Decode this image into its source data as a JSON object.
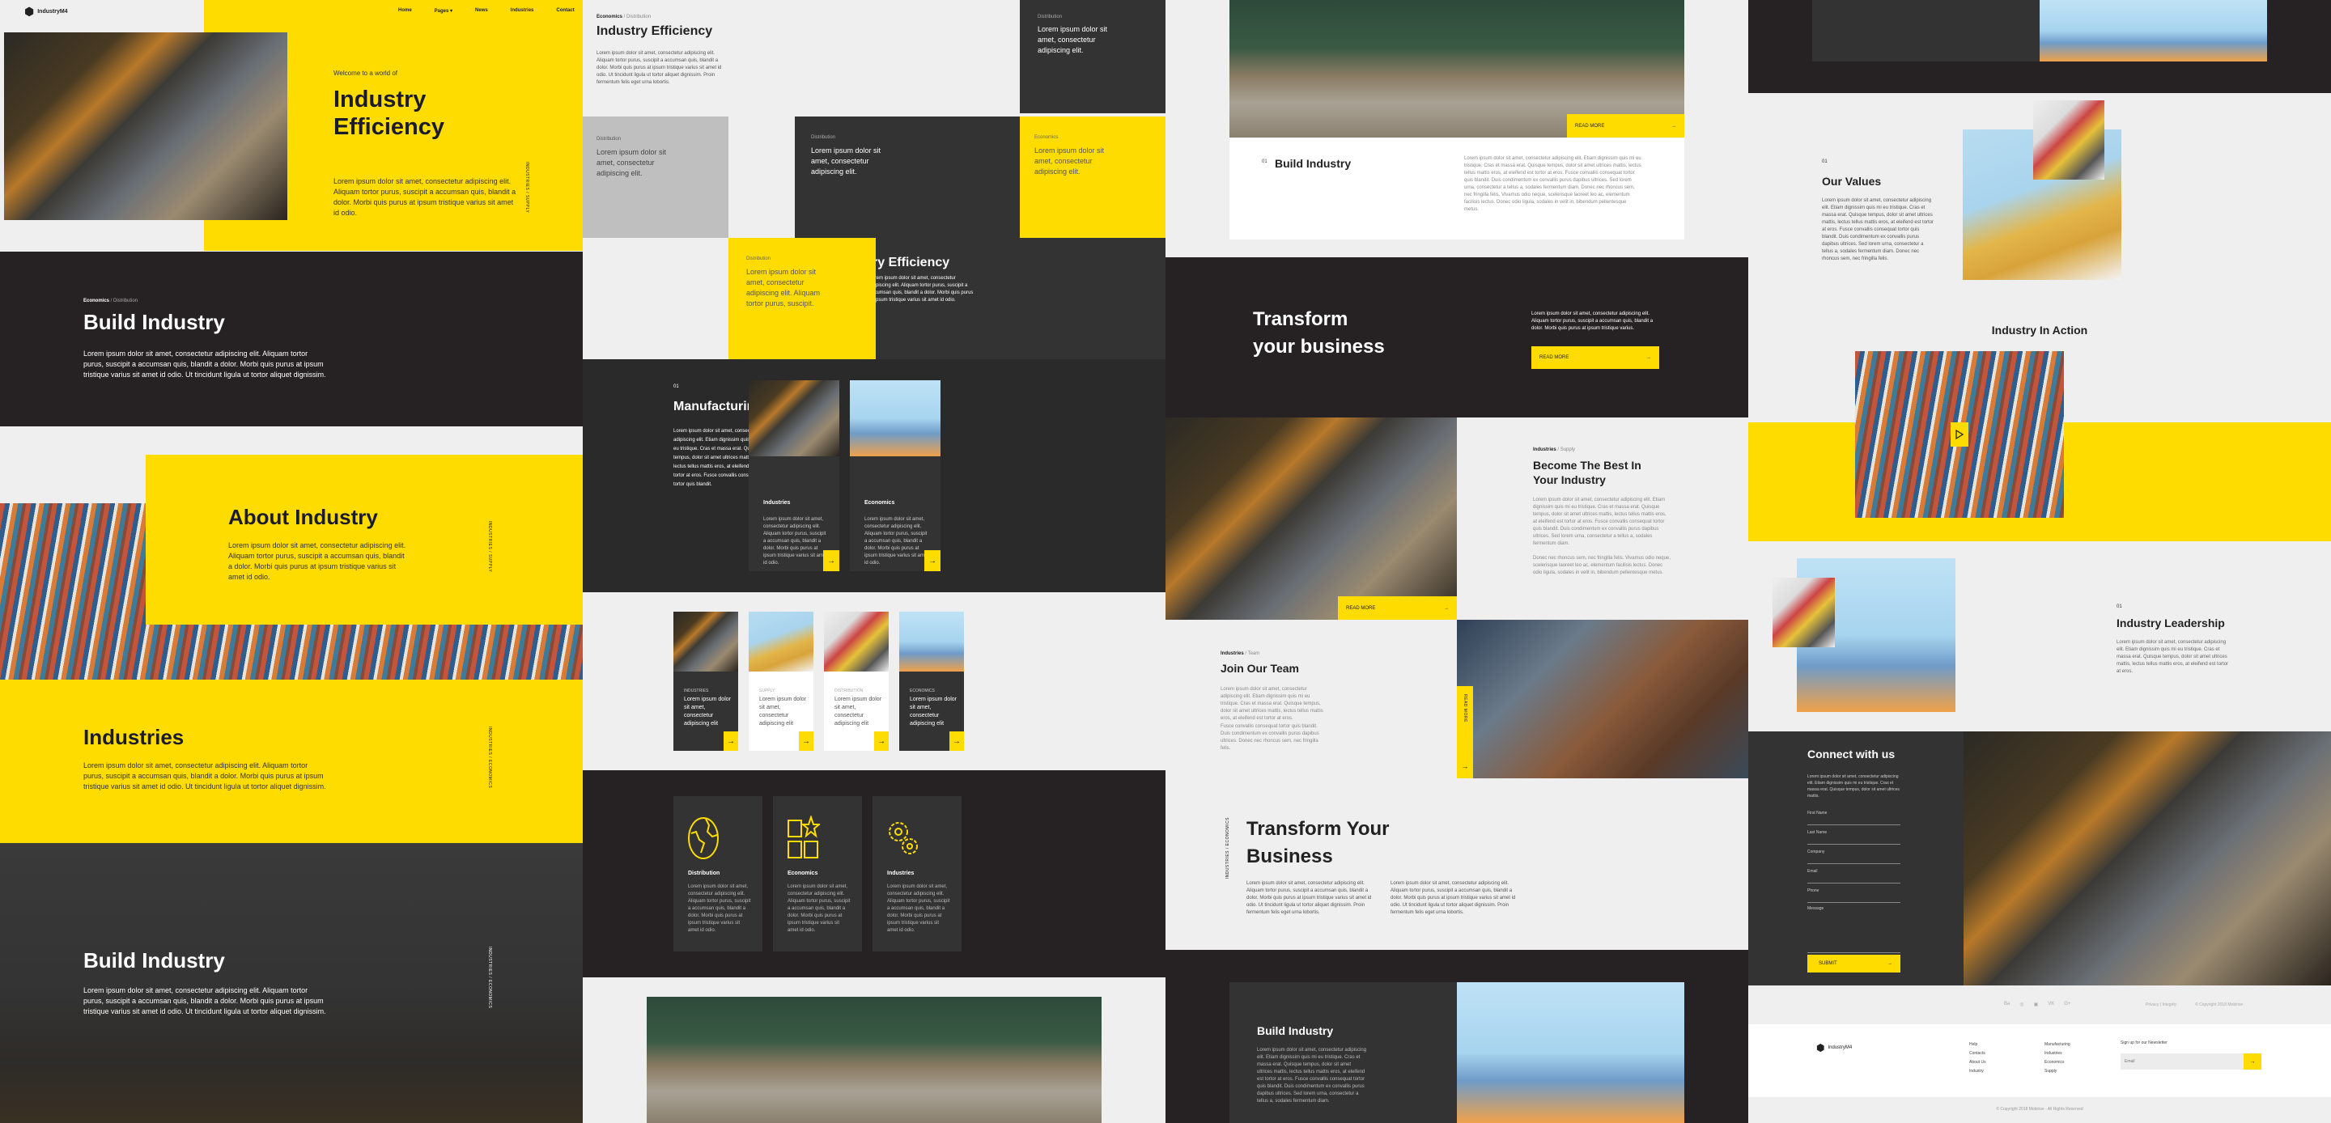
{
  "brand": {
    "name": "IndustryM4"
  },
  "nav": {
    "items": [
      "Home",
      "Pages ▾",
      "News",
      "Industries",
      "Contact"
    ]
  },
  "lorem": {
    "short": "Lorem ipsum dolor sit amet, consectetur adipiscing elit. Aliquam tortor purus, suscipit a accumsan quis, blandit a dolor. Morbi quis purus at ipsum tristique varius sit amet id odio.",
    "medium": "Lorem ipsum dolor sit amet, consectetur adipiscing elit. Aliquam tortor purus, suscipit a accumsan quis, blandit a dolor. Morbi quis purus at ipsum tristique varius sit amet id odio. Ut tincidunt ligula ut tortor aliquet dignissim.",
    "long": "Lorem ipsum dolor sit amet, consectetur adipiscing elit. Aliquam tortor purus, suscipit a accumsan quis, blandit a dolor. Morbi quis purus at ipsum tristique varius sit amet id odio. Ut tincidunt ligula ut tortor aliquet dignissim. Proin fermentum felis eget urna lobortis.",
    "card": "Lorem ipsum dolor sit amet, consectetur adipiscing elit. Aliquam tortor purus, suscipit a accumsan quis, blandit a dolor. Morbi quis purus at ipsum tristique varius sit amet id odio.",
    "tile": "Lorem ipsum dolor sit amet, consectetur adipiscing elit.",
    "tile_long": "Lorem ipsum dolor sit amet, consectetur adipiscing elit. Aliquam tortor purus, suscipit.",
    "small_card": "Lorem ipsum dolor sit amet, consectetur adipiscing elit",
    "manufacturing": "Lorem ipsum dolor sit amet, consectetur adipiscing elit. Etiam dignissim quis mi eu tristique. Cras et massa erat. Quisque tempus, dolor sit amet ultrices mattis, lectus tellus mattis eros, at eleifend est tortor at eros. Fusce convallis consequat tortor quis blandit.",
    "build": "Lorem ipsum dolor sit amet, consectetur adipiscing elit. Etiam dignissim quis mi eu tristique. Cras et massa erat. Quisque tempus, dolor sit amet ultrices mattis, lectus tellus mattis eros, at eleifend est tortor at eros. Fusce convallis consequat tortor quis blandit. Duis condimentum ex convallis purus dapibus ultrices. Sed lorem urna, consectetur a tellus a, sodales fermentum diam. Donec nec rhoncus sem, nec fringilla felis. Vivamus odio neque, scelerisque laoreet leo ac, elementum facilisis lectus. Donec odio ligula, sodales in velit in, bibendum pellentesque metus.",
    "transform": "Lorem ipsum dolor sit amet, consectetur adipiscing elit. Aliquam tortor purus, suscipit a accumsan quis, blandit a dolor. Morbi quis purus at ipsum tristique varius.",
    "become1": "Lorem ipsum dolor sit amet, consectetur adipiscing elit. Etiam dignissim quis mi eu tristique. Cras et massa erat. Quisque tempus, dolor sit amet ultrices mattis, lectus tellus mattis eros, at eleifend est tortor at eros. Fusce convallis consequat tortor quis blandit. Duis condimentum ex convallis purus dapibus ultrices. Sed lorem urna, consectetur a tellus a, sodales fermentum diam.",
    "become2": "Donec nec rhoncus sem, nec fringilla felis. Vivamus odio neque, scelerisque laoreet leo ac, elementum facilisis lectus. Donec odio ligula, sodales in velit in, bibendum pellentesque metus.",
    "team1": "Lorem ipsum dolor sit amet, consectetur adipiscing elit. Etiam dignissim quis mi eu tristique. Cras et massa erat. Quisque tempus, dolor sit amet ultrices mattis, lectus tellus mattis eros, at eleifend est tortor at eros.",
    "team2": "Fusce convallis consequat tortor quis blandit. Duis condimentum ex convallis purus dapibus ultrices. Donec nec rhoncus sem, nec fringilla felis.",
    "build_dark": "Lorem ipsum dolor sit amet, consectetur adipiscing elit. Etiam dignissim quis mi eu tristique. Cras et massa erat. Quisque tempus, dolor sit amet ultrices mattis, lectus tellus mattis eros, at eleifend est tortor at eros. Fusce convallis consequat tortor quis blandit. Duis condimentum ex convallis purus dapibus ultrices. Sed lorem urna, consectetur a tellus a, sodales fermentum diam.",
    "values": "Lorem ipsum dolor sit amet, consectetur adipiscing elit. Etiam dignissim quis mi eu tristique. Cras et massa erat. Quisque tempus, dolor sit amet ultrices mattis, lectus tellus mattis eros, at eleifend est tortor at eros. Fusce convallis consequat tortor quis blandit. Duis condimentum ex convallis purus dapibus ultrices. Sed lorem urna, consectetur a tellus a, sodales fermentum diam. Donec nec rhoncus sem, nec fringilla felis.",
    "leadership": "Lorem ipsum dolor sit amet, consectetur adipiscing elit. Etiam dignissim quis mi eu tristique. Cras et massa erat. Quisque tempus, dolor sit amet ultrices mattis, lectus tellus mattis eros, at eleifend est tortor at eros.",
    "connect": "Lorem ipsum dolor sit amet, consectetur adipiscing elit. Etiam dignissim quis mi eu tristique. Cras et massa erat. Quisque tempus, dolor sit amet ultrices mattis."
  },
  "col1": {
    "hero": {
      "kicker": "Welcome to a world of",
      "title": "Industry Efficiency",
      "vertical": "INDUSTRIES / SUPPLY"
    },
    "build": {
      "crumb_bold": "Economics",
      "crumb_rest": " / Distribution",
      "title": "Build Industry"
    },
    "about": {
      "title": "About Industry",
      "vertical": "INDUSTRIES / SUPPLY"
    },
    "industries": {
      "title": "Industries",
      "vertical": "INDUSTRIES / ECONOMICS"
    },
    "build2": {
      "title": "Build Industry",
      "vertical": "INDUSTRIES / ECONOMICS"
    }
  },
  "col2": {
    "eff": {
      "crumb_bold": "Economics",
      "crumb_rest": " / Distribution",
      "title": "Industry Efficiency"
    },
    "tiles": [
      {
        "label": "Distribution"
      },
      {
        "label": "Distribution"
      },
      {
        "label": "Distribution"
      },
      {
        "label": "Economics"
      },
      {
        "label": "Distribution"
      }
    ],
    "eff_dark_title": "Industry Efficiency",
    "manufacturing": {
      "num": "01",
      "title": "Manufacturing",
      "cards": [
        {
          "title": "Industries"
        },
        {
          "title": "Economics"
        }
      ]
    },
    "small_cards": [
      {
        "label": "INDUSTRIES"
      },
      {
        "label": "SUPPLY"
      },
      {
        "label": "DISTRIBUTION"
      },
      {
        "label": "ECONOMICS"
      }
    ],
    "features": [
      {
        "title": "Distribution",
        "icon": "globe-icon"
      },
      {
        "title": "Economics",
        "icon": "apps-star-icon"
      },
      {
        "title": "Industries",
        "icon": "gears-icon"
      }
    ]
  },
  "col3": {
    "read_more": "READ MORE",
    "build": {
      "num": "01",
      "title": "Build Industry"
    },
    "transform": {
      "title": "Transform your business"
    },
    "become": {
      "crumb_bold": "Industries",
      "crumb_rest": " / Supply",
      "title": "Become The Best In Your Industry"
    },
    "team": {
      "crumb_bold": "Industries",
      "crumb_rest": " / Team",
      "title": "Join Our Team"
    },
    "transform2": {
      "title": "Transform Your Business",
      "vertical": "INDUSTRIES / ECONOMICS"
    },
    "build_dark": {
      "title": "Build Industry"
    }
  },
  "col4": {
    "values": {
      "num": "01",
      "title": "Our Values"
    },
    "action": {
      "title": "Industry In Action"
    },
    "leadership": {
      "num": "01",
      "title": "Industry Leadership"
    },
    "connect": {
      "title": "Connect with us",
      "fields": [
        "First Name",
        "Last Name",
        "Company",
        "Email",
        "Phone",
        "Message"
      ],
      "submit": "SUBMIT"
    },
    "footer": {
      "social": [
        "Behance",
        "Dribbble",
        "Instagram",
        "VK",
        "Google Plus"
      ],
      "social_glyphs": [
        "Bə",
        "◎",
        "▣",
        "VK",
        "G+"
      ],
      "privacy": "Privacy | Integrity",
      "copyright_top": "© Copyright 2018 Mobirise",
      "links_col1": [
        "Help",
        "Contacts",
        "About Us",
        "Industry"
      ],
      "links_col2": [
        "Manufacturing",
        "Industries",
        "Economics",
        "Supply"
      ],
      "newsletter_label": "Sign up for our Newsletter",
      "email_placeholder": "Email",
      "copyright_bottom": "© Copyright 2018 Mobirise - All Rights Reserved"
    }
  },
  "colors": {
    "accent": "#ffdc00",
    "dark": "#262223",
    "panel": "#333333",
    "light": "#efefef"
  }
}
